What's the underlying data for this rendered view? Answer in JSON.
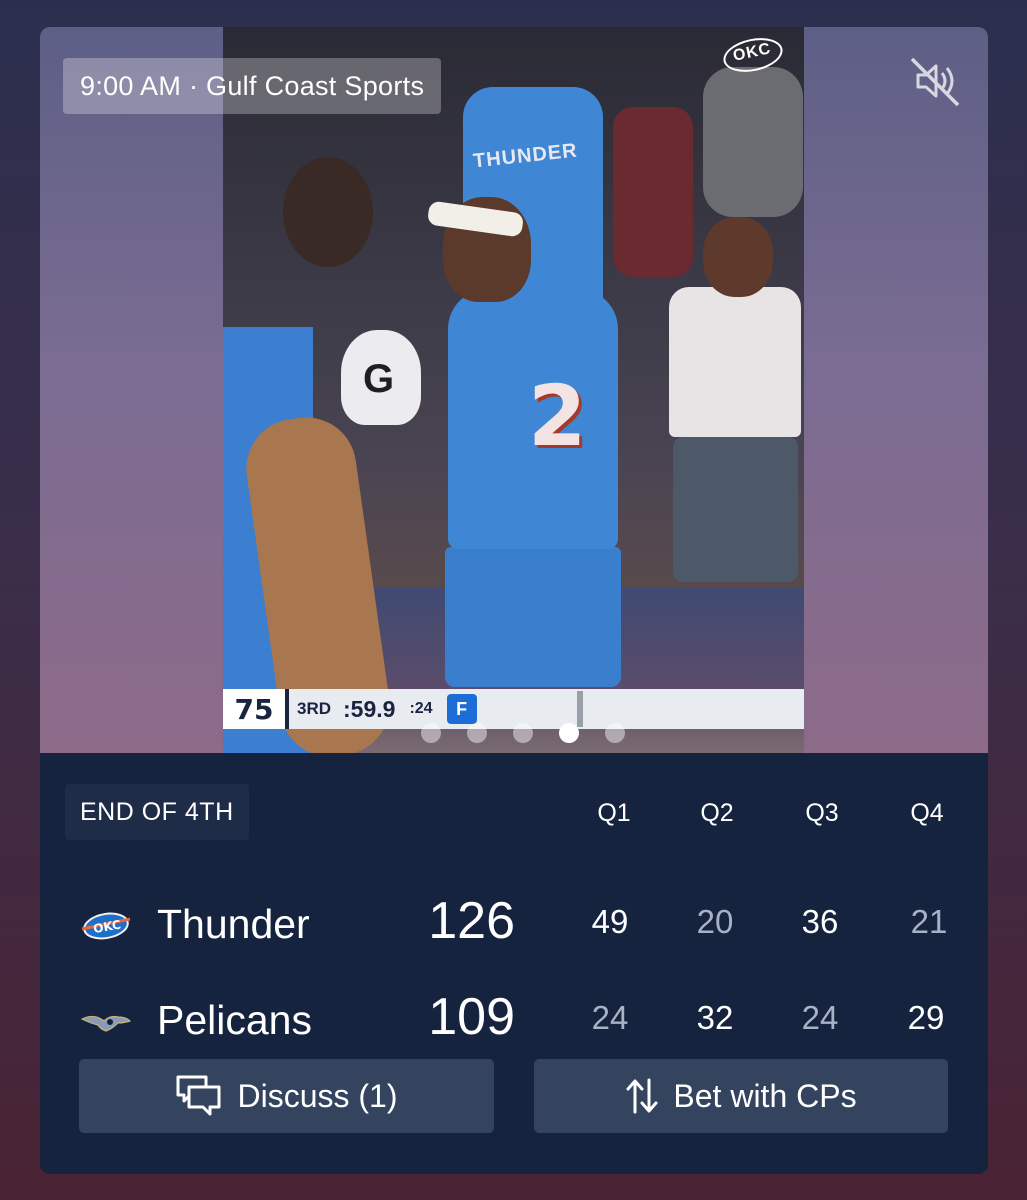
{
  "media": {
    "timestamp": "9:00 AM · Gulf Coast Sports",
    "mute_icon": "speaker-muted-icon",
    "carousel": {
      "count": 5,
      "active_index": 3
    },
    "video": {
      "jersey_number": "2",
      "background_jersey_text": "THUNDER",
      "watermark": "OKC",
      "scorebug": {
        "score": "75",
        "period": "3RD",
        "clock": ":59.9",
        "shot_clock": ":24",
        "sponsor": "F"
      }
    }
  },
  "game": {
    "status": "END OF 4TH",
    "quarter_labels": [
      "Q1",
      "Q2",
      "Q3",
      "Q4"
    ],
    "teams": [
      {
        "name": "Thunder",
        "logo": "thunder-logo",
        "total": "126",
        "quarters": [
          "49",
          "20",
          "36",
          "21"
        ],
        "quarter_win": [
          true,
          false,
          true,
          false
        ]
      },
      {
        "name": "Pelicans",
        "logo": "pelicans-logo",
        "total": "109",
        "quarters": [
          "24",
          "32",
          "24",
          "29"
        ],
        "quarter_win": [
          false,
          true,
          false,
          true
        ]
      }
    ]
  },
  "actions": {
    "discuss": {
      "label": "Discuss (1)",
      "icon": "chat-bubbles-icon"
    },
    "bet": {
      "label": "Bet with CPs",
      "icon": "up-down-arrows-icon"
    }
  },
  "colors": {
    "card_background": "#15233f",
    "button_background": "#34445e",
    "muted_score": "#a9b2c4"
  }
}
